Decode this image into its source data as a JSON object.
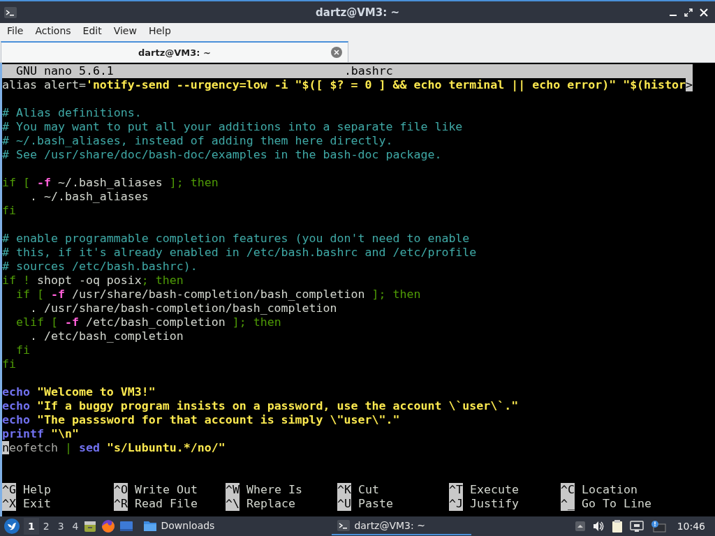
{
  "window": {
    "title": "dartz@VM3: ~"
  },
  "menu": [
    "File",
    "Actions",
    "Edit",
    "View",
    "Help"
  ],
  "tabs": [
    {
      "label": "dartz@VM3: ~",
      "selected": true
    }
  ],
  "nano": {
    "version": "GNU nano 5.6.1",
    "filename": ".bashrc",
    "lines": [
      {
        "kind": "code",
        "segments": [
          {
            "kind": "plain",
            "text": "alias alert="
          },
          {
            "kind": "string",
            "text": "'notify-send --urgency=low -i \"$([ $? = 0 ] && echo terminal || echo error)\" \"$(histor"
          },
          {
            "kind": "marker",
            "text": ">"
          }
        ]
      },
      {
        "kind": "blank"
      },
      {
        "kind": "code",
        "segments": [
          {
            "kind": "comment",
            "text": "# Alias definitions."
          }
        ]
      },
      {
        "kind": "code",
        "segments": [
          {
            "kind": "comment",
            "text": "# You may want to put all your additions into a separate file like"
          }
        ]
      },
      {
        "kind": "code",
        "segments": [
          {
            "kind": "comment",
            "text": "# ~/.bash_aliases, instead of adding them here directly."
          }
        ]
      },
      {
        "kind": "code",
        "segments": [
          {
            "kind": "comment",
            "text": "# See /usr/share/doc/bash-doc/examples in the bash-doc package."
          }
        ]
      },
      {
        "kind": "blank"
      },
      {
        "kind": "code",
        "segments": [
          {
            "kind": "keyword",
            "text": "if [ "
          },
          {
            "kind": "flag",
            "text": "-f"
          },
          {
            "kind": "plain",
            "text": " ~/.bash_aliases "
          },
          {
            "kind": "keyword",
            "text": "]; then"
          }
        ]
      },
      {
        "kind": "code",
        "segments": [
          {
            "kind": "plain",
            "text": "    . ~/.bash_aliases"
          }
        ]
      },
      {
        "kind": "code",
        "segments": [
          {
            "kind": "keyword",
            "text": "fi"
          }
        ]
      },
      {
        "kind": "blank"
      },
      {
        "kind": "code",
        "segments": [
          {
            "kind": "comment",
            "text": "# enable programmable completion features (you don't need to enable"
          }
        ]
      },
      {
        "kind": "code",
        "segments": [
          {
            "kind": "comment",
            "text": "# this, if it's already enabled in /etc/bash.bashrc and /etc/profile"
          }
        ]
      },
      {
        "kind": "code",
        "segments": [
          {
            "kind": "comment",
            "text": "# sources /etc/bash.bashrc)."
          }
        ]
      },
      {
        "kind": "code",
        "segments": [
          {
            "kind": "keyword",
            "text": "if ! "
          },
          {
            "kind": "plain",
            "text": "shopt -oq posix"
          },
          {
            "kind": "keyword",
            "text": "; then"
          }
        ]
      },
      {
        "kind": "code",
        "segments": [
          {
            "kind": "keyword",
            "text": "  if [ "
          },
          {
            "kind": "flag",
            "text": "-f"
          },
          {
            "kind": "plain",
            "text": " /usr/share/bash-completion/bash_completion "
          },
          {
            "kind": "keyword",
            "text": "]; then"
          }
        ]
      },
      {
        "kind": "code",
        "segments": [
          {
            "kind": "plain",
            "text": "    . /usr/share/bash-completion/bash_completion"
          }
        ]
      },
      {
        "kind": "code",
        "segments": [
          {
            "kind": "keyword",
            "text": "  elif [ "
          },
          {
            "kind": "flag",
            "text": "-f"
          },
          {
            "kind": "plain",
            "text": " /etc/bash_completion "
          },
          {
            "kind": "keyword",
            "text": "]; then"
          }
        ]
      },
      {
        "kind": "code",
        "segments": [
          {
            "kind": "plain",
            "text": "    . /etc/bash_completion"
          }
        ]
      },
      {
        "kind": "code",
        "segments": [
          {
            "kind": "keyword",
            "text": "  fi"
          }
        ]
      },
      {
        "kind": "code",
        "segments": [
          {
            "kind": "keyword",
            "text": "fi"
          }
        ]
      },
      {
        "kind": "blank"
      },
      {
        "kind": "code",
        "segments": [
          {
            "kind": "builtin",
            "text": "echo"
          },
          {
            "kind": "string",
            "text": " \"Welcome to VM3!\""
          }
        ]
      },
      {
        "kind": "code",
        "segments": [
          {
            "kind": "builtin",
            "text": "echo"
          },
          {
            "kind": "string",
            "text": " \"If a buggy program insists on a password, use the account \\`user\\`.\""
          }
        ]
      },
      {
        "kind": "code",
        "segments": [
          {
            "kind": "builtin",
            "text": "echo"
          },
          {
            "kind": "string",
            "text": " \"The passsword for that account is simply \\\"user\\\".\""
          }
        ]
      },
      {
        "kind": "code",
        "segments": [
          {
            "kind": "builtin",
            "text": "printf"
          },
          {
            "kind": "string",
            "text": " \"\\n\""
          }
        ]
      },
      {
        "kind": "code",
        "segments": [
          {
            "kind": "cursor",
            "text": "n"
          },
          {
            "kind": "dim",
            "text": "eofetch "
          },
          {
            "kind": "keyword",
            "text": "| "
          },
          {
            "kind": "builtin",
            "text": "sed "
          },
          {
            "kind": "string",
            "text": "\"s/Lubuntu.*/no/\""
          }
        ]
      }
    ],
    "shortcuts": [
      {
        "key": "^G",
        "label": "Help"
      },
      {
        "key": "^O",
        "label": "Write Out"
      },
      {
        "key": "^W",
        "label": "Where Is"
      },
      {
        "key": "^K",
        "label": "Cut"
      },
      {
        "key": "^T",
        "label": "Execute"
      },
      {
        "key": "^C",
        "label": "Location"
      },
      {
        "key": "^X",
        "label": "Exit"
      },
      {
        "key": "^R",
        "label": "Read File"
      },
      {
        "key": "^\\",
        "label": "Replace"
      },
      {
        "key": "^U",
        "label": "Paste"
      },
      {
        "key": "^J",
        "label": "Justify"
      },
      {
        "key": "^_",
        "label": "Go To Line"
      }
    ]
  },
  "taskbar": {
    "workspaces": [
      {
        "label": "1",
        "selected": true
      },
      {
        "label": "2",
        "selected": false
      },
      {
        "label": "3",
        "selected": false
      },
      {
        "label": "4",
        "selected": false
      }
    ],
    "tasks": [
      {
        "label": "Downloads",
        "kind": "folder",
        "selected": false
      },
      {
        "label": "dartz@VM3: ~",
        "kind": "terminal",
        "selected": true
      }
    ],
    "clock": "10:46"
  }
}
